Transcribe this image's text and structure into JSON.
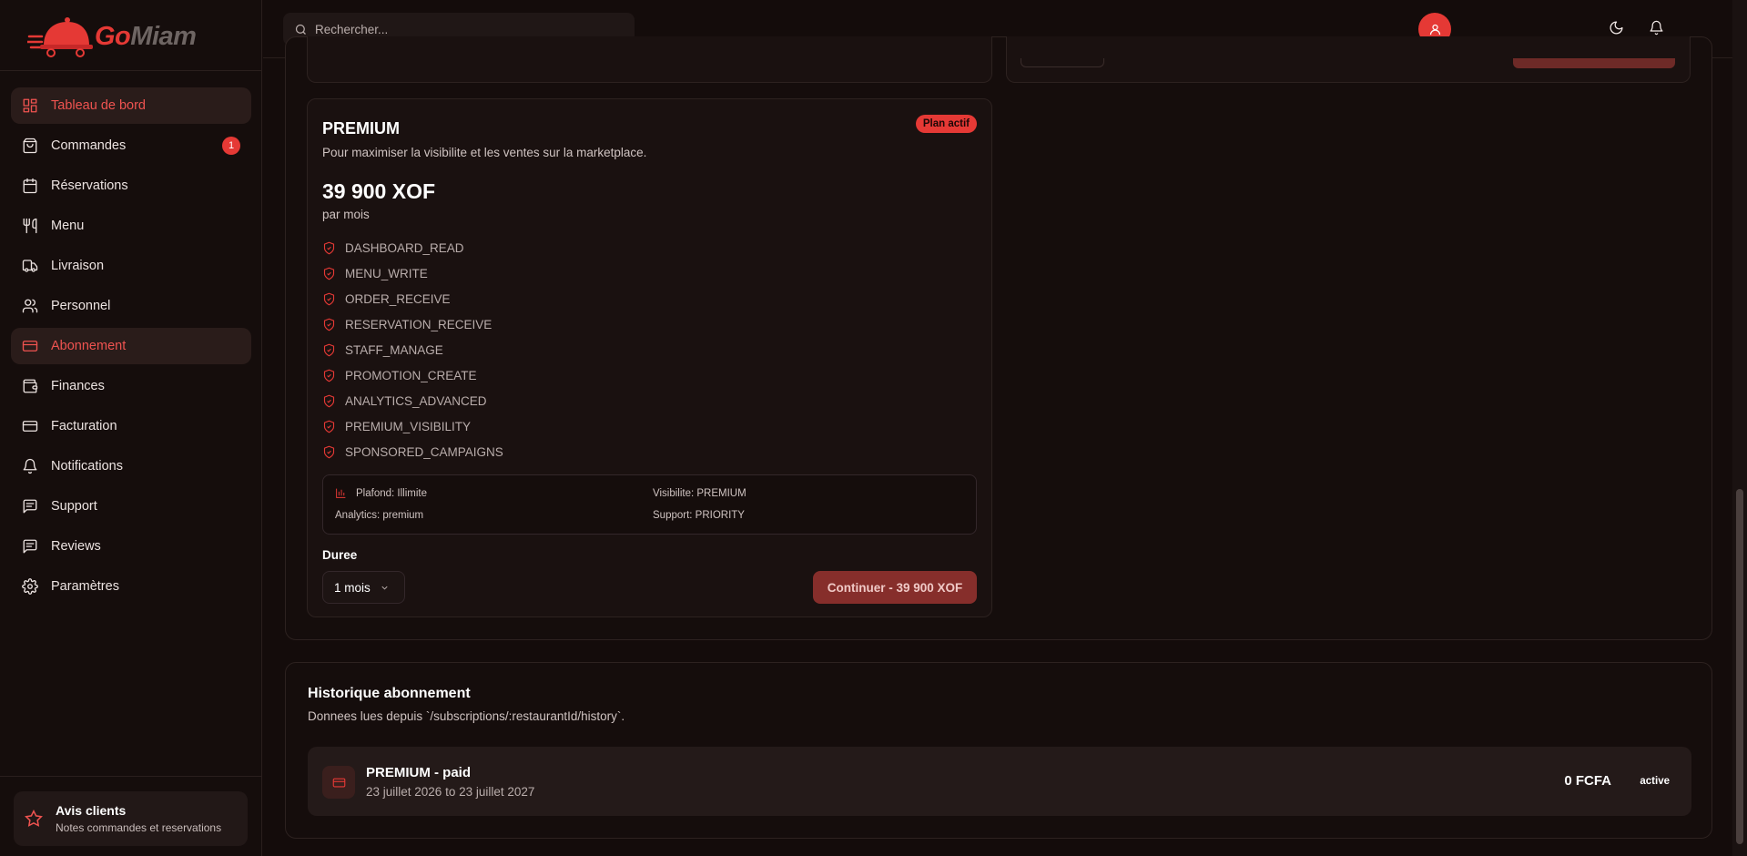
{
  "brand": {
    "go": "Go",
    "miam": "Miam",
    "accent": "#e53935"
  },
  "sidebar": {
    "items": [
      {
        "label": "Tableau de bord",
        "icon": "dashboard-icon",
        "active": true
      },
      {
        "label": "Commandes",
        "icon": "shopping-bag-icon",
        "badge": "1"
      },
      {
        "label": "Réservations",
        "icon": "calendar-icon"
      },
      {
        "label": "Menu",
        "icon": "utensils-icon"
      },
      {
        "label": "Livraison",
        "icon": "truck-icon"
      },
      {
        "label": "Personnel",
        "icon": "users-icon"
      },
      {
        "label": "Abonnement",
        "icon": "credit-card-icon",
        "active": true
      },
      {
        "label": "Finances",
        "icon": "wallet-icon"
      },
      {
        "label": "Facturation",
        "icon": "billing-card-icon"
      },
      {
        "label": "Notifications",
        "icon": "bell-icon"
      },
      {
        "label": "Support",
        "icon": "message-icon"
      },
      {
        "label": "Reviews",
        "icon": "review-message-icon"
      },
      {
        "label": "Paramètres",
        "icon": "gear-icon"
      }
    ],
    "review_card": {
      "title": "Avis clients",
      "subtitle": "Notes commandes et reservations"
    }
  },
  "topbar": {
    "search_placeholder": "Rechercher..."
  },
  "plan": {
    "name": "PREMIUM",
    "description": "Pour maximiser la visibilite et les ventes sur la marketplace.",
    "badge": "Plan actif",
    "price": "39 900 XOF",
    "period": "par mois",
    "features": [
      "DASHBOARD_READ",
      "MENU_WRITE",
      "ORDER_RECEIVE",
      "RESERVATION_RECEIVE",
      "STAFF_MANAGE",
      "PROMOTION_CREATE",
      "ANALYTICS_ADVANCED",
      "PREMIUM_VISIBILITY",
      "SPONSORED_CAMPAIGNS"
    ],
    "limits": {
      "plafond": "Plafond: Illimite",
      "visibilite": "Visibilite: PREMIUM",
      "analytics": "Analytics: premium",
      "support": "Support: PRIORITY"
    },
    "duree_label": "Duree",
    "duree_value": "1 mois",
    "continue_label": "Continuer - 39 900 XOF"
  },
  "history": {
    "title": "Historique abonnement",
    "subtitle": "Donnees lues depuis `/subscriptions/:restaurantId/history`.",
    "rows": [
      {
        "name": "PREMIUM - paid",
        "dates": "23 juillet 2026 to 23 juillet 2027",
        "amount": "0 FCFA",
        "status": "active"
      }
    ]
  }
}
